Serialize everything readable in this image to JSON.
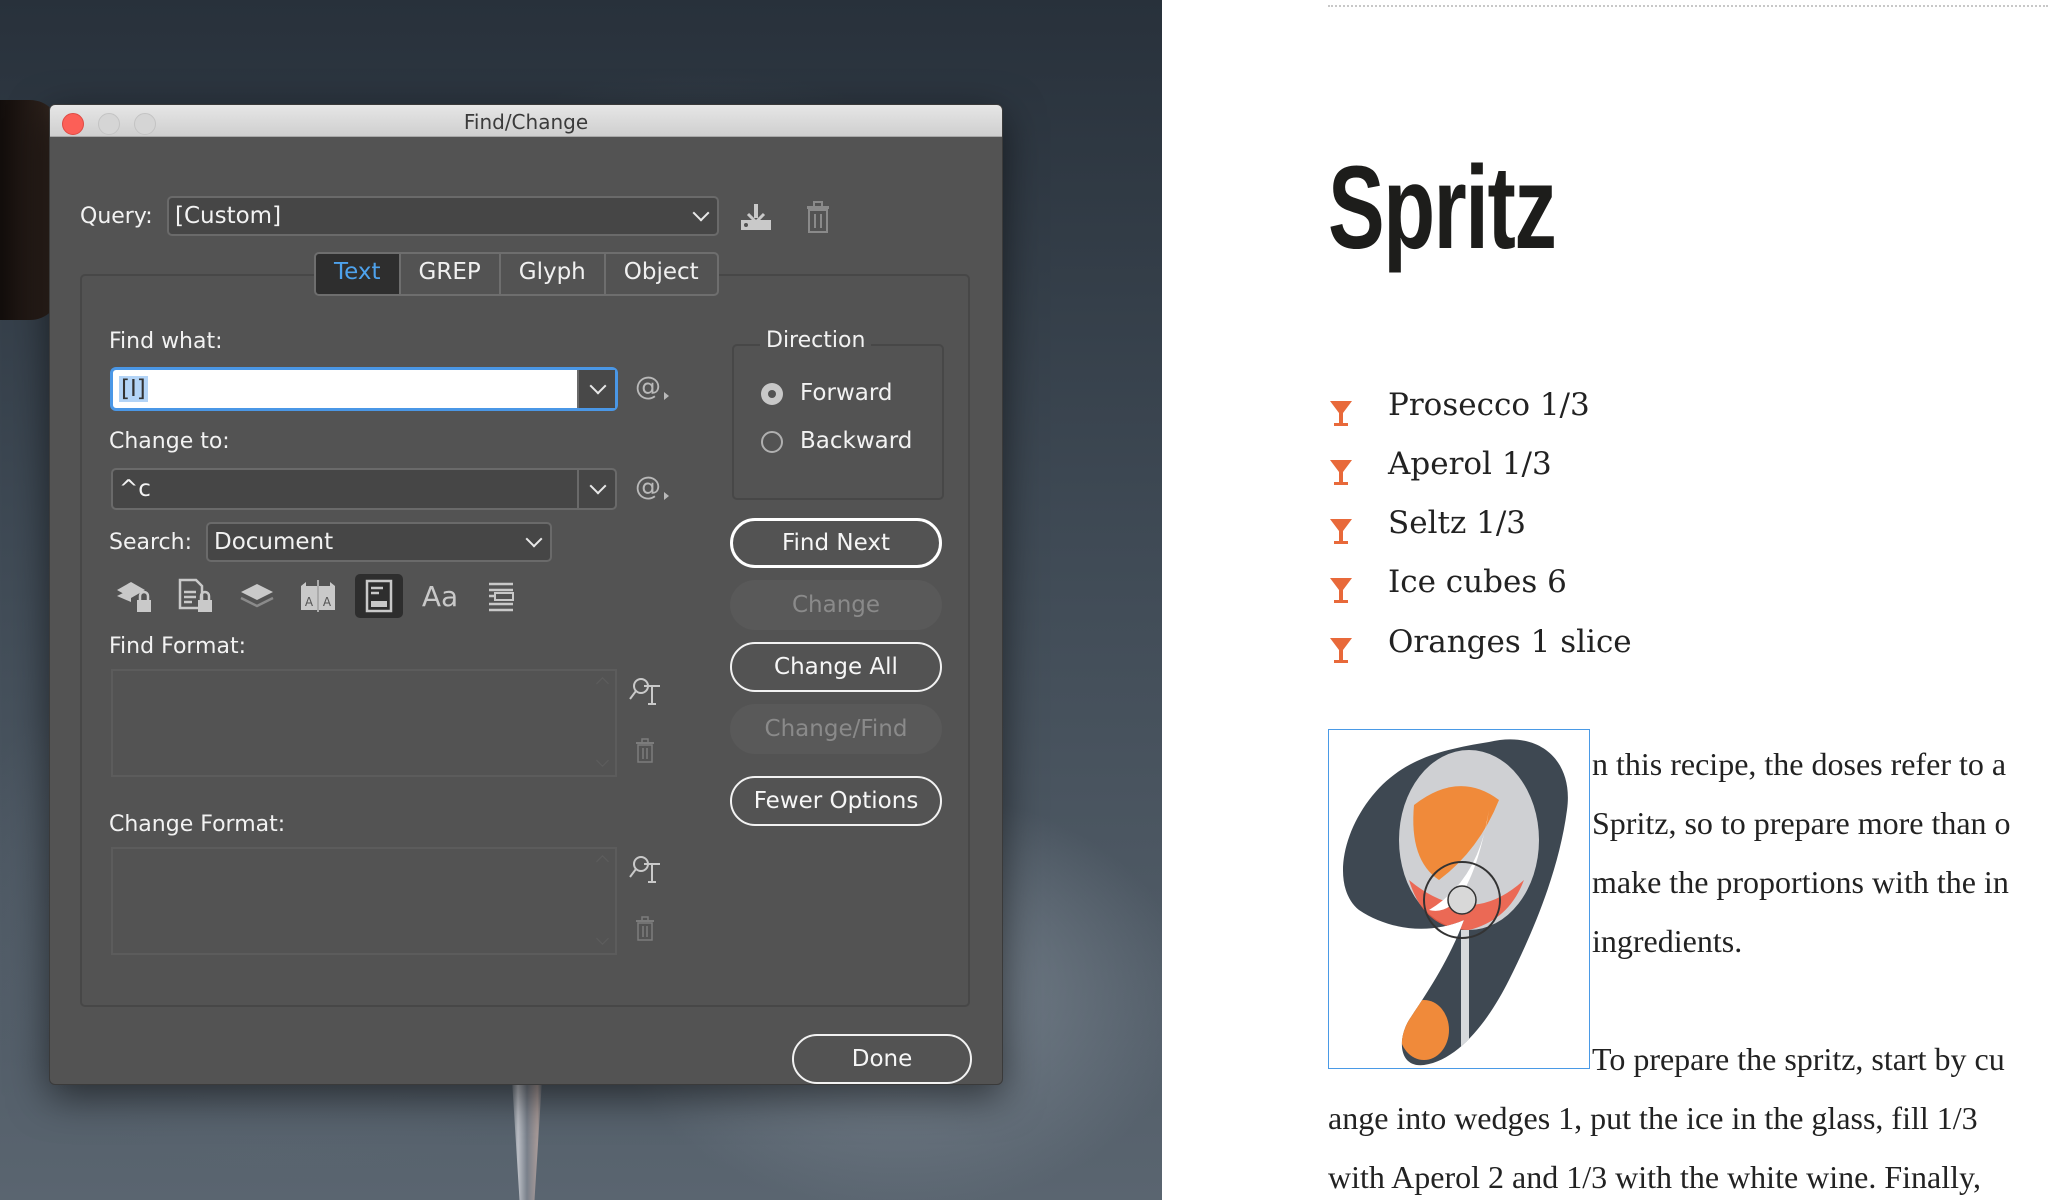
{
  "dialog": {
    "title": "Find/Change",
    "query": {
      "label": "Query:",
      "value": "[Custom]"
    },
    "tabs": [
      {
        "label": "Text",
        "active": true
      },
      {
        "label": "GREP",
        "active": false
      },
      {
        "label": "Glyph",
        "active": false
      },
      {
        "label": "Object",
        "active": false
      }
    ],
    "find_what": {
      "label": "Find what:",
      "value": "[I]"
    },
    "change_to": {
      "label": "Change to:",
      "value": "^c"
    },
    "search": {
      "label": "Search:",
      "value": "Document"
    },
    "search_options": [
      {
        "icon": "locked-layers-icon",
        "on": false
      },
      {
        "icon": "locked-stories-icon",
        "on": false
      },
      {
        "icon": "hidden-layers-icon",
        "on": false
      },
      {
        "icon": "master-pages-icon",
        "on": false
      },
      {
        "icon": "footnotes-icon",
        "on": true
      },
      {
        "icon": "case-sensitive-icon",
        "label": "Aa",
        "on": false
      },
      {
        "icon": "whole-word-icon",
        "on": false
      }
    ],
    "find_format": {
      "label": "Find Format:"
    },
    "change_format": {
      "label": "Change Format:"
    },
    "direction": {
      "label": "Direction",
      "options": [
        {
          "label": "Forward",
          "selected": true
        },
        {
          "label": "Backward",
          "selected": false
        }
      ]
    },
    "buttons": {
      "find_next": "Find Next",
      "change": "Change",
      "change_all": "Change All",
      "change_find": "Change/Find",
      "fewer_options": "Fewer Options",
      "done": "Done"
    },
    "accent_color": "#4ea2ec"
  },
  "document": {
    "title": "Spritz",
    "bullet_color": "#e8693a",
    "ingredients": [
      "Prosecco 1/3",
      "Aperol 1/3",
      "Seltz 1/3",
      "Ice cubes 6",
      "Oranges 1 slice"
    ],
    "body_lines": [
      "n this recipe, the doses refer to a",
      "Spritz, so to prepare more than o",
      "make the proportions with the in",
      "ingredients.",
      "To prepare the spritz, start by cu",
      "ange into wedges 1, put the ice in the glass, fill 1/3",
      "with Aperol 2 and 1/3 with the white wine. Finally,"
    ]
  }
}
